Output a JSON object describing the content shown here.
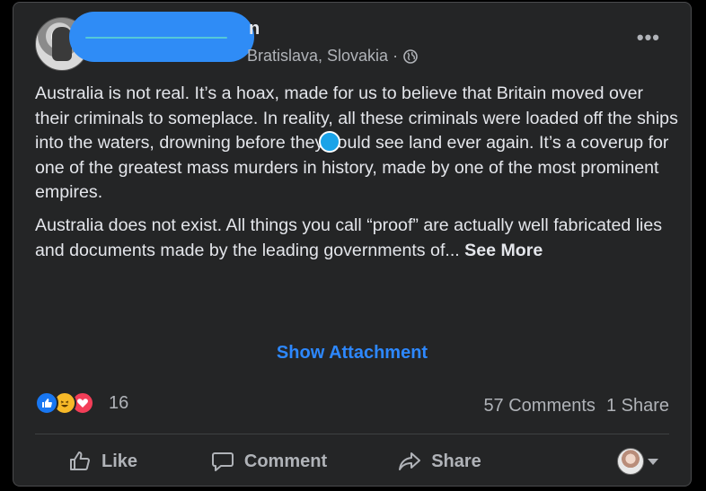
{
  "post": {
    "author_tail": "n",
    "location": "Bratislava, Slovakia ·",
    "more_label": "•••",
    "paragraphs": [
      "Australia is not real. It’s a hoax, made for us to believe that Britain moved over their criminals to someplace. In reality, all these criminals were loaded off the ships into the waters, drowning before they could see land ever again. It’s a coverup for one of the greatest mass murders in history, made by one of the most prominent empires.",
      "Australia does not exist. All things you call “proof” are actually well fabricated lies and documents made by the leading governments of..."
    ],
    "see_more": "See More",
    "attachment_label": "Show Attachment"
  },
  "reactions": {
    "types": [
      "like-icon",
      "haha-icon",
      "love-icon"
    ],
    "count": "16"
  },
  "stats": {
    "comments": "57 Comments",
    "shares": "1 Share"
  },
  "actions": {
    "like": "Like",
    "comment": "Comment",
    "share": "Share"
  },
  "colors": {
    "card_bg": "#242526",
    "text": "#e4e6eb",
    "secondary_text": "#b0b3b8",
    "link_blue": "#2d88ff",
    "redaction": "#2f8cf6"
  }
}
